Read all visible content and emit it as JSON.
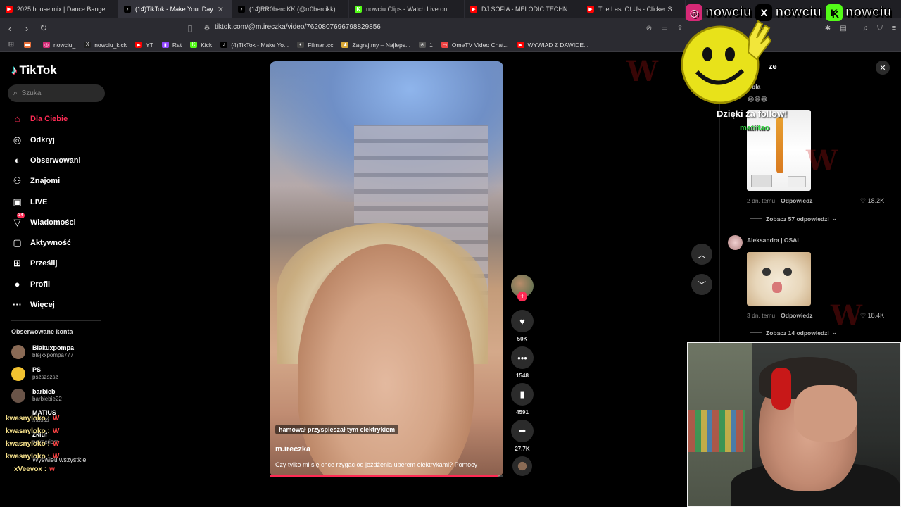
{
  "browser": {
    "tabs": [
      {
        "label": "2025 house mix | Dance Bangers - Yo",
        "color": "#ff0000",
        "glyph": "▶"
      },
      {
        "label": "(14)TikTok - Make Your Day",
        "color": "#000000",
        "glyph": "♪",
        "active": true
      },
      {
        "label": "(14)RR0berciKK (@rr0bercikk) | TikTo",
        "color": "#000000",
        "glyph": "♪"
      },
      {
        "label": "nowciu Clips - Watch Live on Kick",
        "color": "#53fc18",
        "glyph": "K"
      },
      {
        "label": "DJ SOFIA - MELODIC TECHNO & FU",
        "color": "#ff0000",
        "glyph": "▶"
      },
      {
        "label": "The Last Of Us - Clicker Sound Effe",
        "color": "#ff0000",
        "glyph": "▶"
      }
    ],
    "url": "tiktok.com/@m.ireczka/video/7620807696798829856",
    "bookmarks": [
      {
        "label": "",
        "color": "#e8703a",
        "glyph": "▬"
      },
      {
        "label": "nowciu_",
        "color": "#d62976",
        "glyph": "◎"
      },
      {
        "label": "nowciu_kick",
        "color": "#222222",
        "glyph": "X"
      },
      {
        "label": "YT",
        "color": "#ff0000",
        "glyph": "▶"
      },
      {
        "label": "Rat",
        "color": "#9146ff",
        "glyph": "▮"
      },
      {
        "label": "Kick",
        "color": "#53fc18",
        "glyph": "K"
      },
      {
        "label": "(4)TikTok - Make Yo...",
        "color": "#000000",
        "glyph": "♪"
      },
      {
        "label": "Filman.cc",
        "color": "#444444",
        "glyph": "◐"
      },
      {
        "label": "Zagraj.my – Najleps...",
        "color": "#d8a838",
        "glyph": "♟"
      },
      {
        "label": "1",
        "color": "#555555",
        "glyph": "⊘"
      },
      {
        "label": "OmeTV Video Chat...",
        "color": "#e44",
        "glyph": "▭"
      },
      {
        "label": "WYWIAD Z DAWIDE...",
        "color": "#ff0000",
        "glyph": "▶"
      }
    ]
  },
  "sidebar": {
    "logo": "TikTok",
    "search_placeholder": "Szukaj",
    "nav": [
      {
        "label": "Dla Ciebie",
        "icon": "home-icon",
        "glyph": "⌂",
        "active": true
      },
      {
        "label": "Odkryj",
        "icon": "compass-icon",
        "glyph": "◎"
      },
      {
        "label": "Obserwowani",
        "icon": "following-avatar-icon",
        "glyph": "◐"
      },
      {
        "label": "Znajomi",
        "icon": "friends-icon",
        "glyph": "⚇"
      },
      {
        "label": "LIVE",
        "icon": "live-tv-icon",
        "glyph": "▣"
      },
      {
        "label": "Wiadomości",
        "icon": "messages-icon",
        "glyph": "▽",
        "badge": "34"
      },
      {
        "label": "Aktywność",
        "icon": "activity-icon",
        "glyph": "▢"
      },
      {
        "label": "Prześlij",
        "icon": "upload-icon",
        "glyph": "⊞"
      },
      {
        "label": "Profil",
        "icon": "profile-avatar-icon",
        "glyph": "●"
      },
      {
        "label": "Więcej",
        "icon": "more-icon",
        "glyph": "···"
      }
    ],
    "followed_title": "Obserwowane konta",
    "accounts": [
      {
        "name": "Blakuxpompa",
        "handle": "blejkxpompa777",
        "color": "#8a6a55"
      },
      {
        "name": "PS",
        "handle": "pszszszsz",
        "color": "#f2c230"
      },
      {
        "name": "barbieb",
        "handle": "barbiebie22",
        "color": "#6a5448"
      },
      {
        "name": "MATIUS",
        "handle": "matius",
        "color": "#555555"
      },
      {
        "name": "2kiuf",
        "handle": "pokecriom",
        "color": "#7a7a7a"
      }
    ],
    "show_all": "Wyświetl wszystkie"
  },
  "chat": [
    {
      "user": "kwasnyloko :",
      "msg": "W"
    },
    {
      "user": "kwasnyloko :",
      "msg": "W"
    },
    {
      "user": "kwasnyloko :",
      "msg": "W"
    },
    {
      "user": "kwasnyloko :",
      "msg": "W"
    },
    {
      "user": "xVeevox :",
      "msg": "w"
    }
  ],
  "video": {
    "caption_tag": "hamował przyspieszał tym elektrykiem",
    "author": "m.ireczka",
    "description": "Czy tylko mi się chce rzygac od jeżdżenia uberem elektrykami? Pomocy",
    "progress": 0.98,
    "likes": "50K",
    "comments": "1548",
    "saves": "4591",
    "shares": "27.7K"
  },
  "comments_panel": {
    "title_partial": "ze",
    "first_user": "bla",
    "first_emojis": "😄😄😄",
    "comment1": {
      "time": "2 dn. temu",
      "reply": "Odpowiedz",
      "likes": "18.2K",
      "more": "Zobacz 57 odpowiedzi"
    },
    "comment2": {
      "user": "Aleksandra | OSAI",
      "time": "3 dn. temu",
      "reply": "Odpowiedz",
      "likes": "18.4K",
      "more": "Zobacz 14 odpowiedzi"
    }
  },
  "overlay": {
    "socials": [
      {
        "label": "nowciu",
        "icon": "instagram-icon",
        "color": "#d62976",
        "glyph": "◎"
      },
      {
        "label": "nowciu",
        "icon": "x-icon",
        "color": "#000000",
        "glyph": "X"
      },
      {
        "label": "nowciu",
        "icon": "kick-icon",
        "color": "#53fc18",
        "glyph": "K"
      }
    ],
    "follow_thanks": "Dzięki za follow!",
    "follower": "matiitao"
  }
}
